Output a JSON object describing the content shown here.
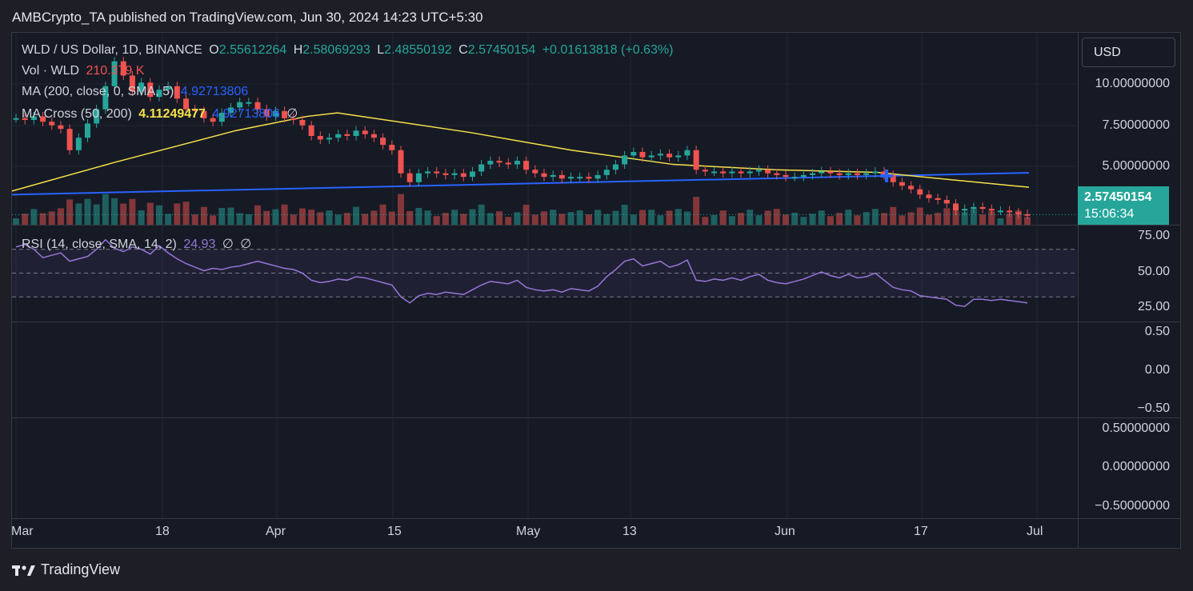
{
  "header": {
    "publish_text": "AMBCrypto_TA published on TradingView.com, Jun 30, 2024 14:23 UTC+5:30"
  },
  "legend": {
    "symbol": "WLD / US Dollar, 1D, BINANCE",
    "open_label": "O",
    "open": "2.55612264",
    "high_label": "H",
    "high": "2.58069293",
    "low_label": "L",
    "low": "2.48550192",
    "close_label": "C",
    "close": "2.57450154",
    "change": "+0.01613818 (+0.63%)",
    "vol_label": "Vol · WLD",
    "vol_value": "210.379 K",
    "ma_label": "MA (200, close, 0, SMA, 5)",
    "ma_value": "4.92713806",
    "macross_label": "MA Cross (50, 200)",
    "macross_value1": "4.11249477",
    "macross_value2": "4.92713806",
    "macross_extra": "∅",
    "rsi_label": "RSI (14, close, SMA, 14, 2)",
    "rsi_value": "24.93",
    "rsi_extra1": "∅",
    "rsi_extra2": "∅"
  },
  "currency_button": "USD",
  "price_axis": [
    "10.00000000",
    "7.50000000",
    "5.00000000"
  ],
  "last_price": "2.57450154",
  "countdown": "15:06:34",
  "rsi_axis": [
    "75.00",
    "50.00",
    "25.00"
  ],
  "pane3_axis": [
    "0.50",
    "0.00",
    "−0.50"
  ],
  "pane4_axis": [
    "0.50000000",
    "0.00000000",
    "−0.50000000"
  ],
  "time_axis": [
    "Mar",
    "18",
    "Apr",
    "15",
    "May",
    "13",
    "Jun",
    "17",
    "Jul"
  ],
  "brand": "TradingView",
  "colors": {
    "up": "#26a69a",
    "down": "#ef5350",
    "ma200": "#2962ff",
    "ma50": "#f7e14a",
    "rsi": "#9677d6",
    "background": "#161a25"
  },
  "chart_data": {
    "type": "candlestick",
    "symbol": "WLD / US Dollar, 1D, BINANCE",
    "x_range": [
      "Mar",
      "Jul"
    ],
    "price_ylim": [
      2.5,
      11.5
    ],
    "price_series_close": [
      8.0,
      7.9,
      8.1,
      7.8,
      7.6,
      7.4,
      6.2,
      6.9,
      7.7,
      8.5,
      9.8,
      11.2,
      10.4,
      9.5,
      10.0,
      9.2,
      9.6,
      9.8,
      9.1,
      8.5,
      8.4,
      8.0,
      7.8,
      8.3,
      8.6,
      8.9,
      8.9,
      8.5,
      8.1,
      8.4,
      8.0,
      7.9,
      7.6,
      7.0,
      6.8,
      6.9,
      7.1,
      7.0,
      7.3,
      7.1,
      6.9,
      6.5,
      6.2,
      4.9,
      4.4,
      4.9,
      5.0,
      4.9,
      4.8,
      4.9,
      4.7,
      5.0,
      5.4,
      5.6,
      5.5,
      5.4,
      5.6,
      5.1,
      4.9,
      4.7,
      4.8,
      4.6,
      4.7,
      4.7,
      4.6,
      4.8,
      5.1,
      5.4,
      5.9,
      6.1,
      5.8,
      5.9,
      6.0,
      5.8,
      5.9,
      6.2,
      5.1,
      5.0,
      5.0,
      4.9,
      5.0,
      4.9,
      5.0,
      5.1,
      4.9,
      4.8,
      4.7,
      4.7,
      4.8,
      4.9,
      5.0,
      4.9,
      4.8,
      4.9,
      4.8,
      4.9,
      5.0,
      4.8,
      4.4,
      4.2,
      4.0,
      3.7,
      3.5,
      3.4,
      3.2,
      2.8,
      2.9,
      3.0,
      2.9,
      2.8,
      2.8,
      2.7,
      2.6,
      2.57
    ],
    "ma200": {
      "name": "MA (200, close, 0, SMA, 5)",
      "start": 3.7,
      "end": 4.92713806
    },
    "ma50": {
      "name": "MA Cross (50, 200)",
      "points": [
        [
          0,
          3.9
        ],
        [
          0.1,
          5.5
        ],
        [
          0.22,
          7.3
        ],
        [
          0.29,
          8.1
        ],
        [
          0.32,
          8.3
        ],
        [
          0.45,
          7.2
        ],
        [
          0.55,
          6.2
        ],
        [
          0.65,
          5.4
        ],
        [
          0.75,
          5.1
        ],
        [
          0.85,
          4.95
        ],
        [
          1.0,
          4.11249477
        ]
      ]
    },
    "cross_marker_fraction": 0.86,
    "volume_units": "K",
    "rsi_ylim": [
      10,
      90
    ],
    "rsi_levels": [
      70,
      50,
      30
    ],
    "rsi_series": [
      72,
      74,
      70,
      63,
      65,
      67,
      60,
      62,
      64,
      70,
      78,
      71,
      68,
      72,
      70,
      66,
      73,
      67,
      62,
      58,
      55,
      52,
      54,
      53,
      55,
      56,
      58,
      60,
      58,
      56,
      54,
      53,
      50,
      44,
      42,
      43,
      45,
      44,
      47,
      46,
      44,
      42,
      40,
      30,
      25,
      31,
      33,
      32,
      34,
      33,
      32,
      36,
      40,
      43,
      42,
      41,
      44,
      38,
      36,
      35,
      36,
      34,
      37,
      36,
      35,
      39,
      47,
      53,
      60,
      62,
      56,
      58,
      60,
      55,
      57,
      61,
      44,
      43,
      45,
      44,
      46,
      44,
      47,
      49,
      44,
      42,
      41,
      43,
      45,
      48,
      51,
      48,
      46,
      49,
      46,
      47,
      50,
      44,
      38,
      36,
      35,
      31,
      30,
      29,
      28,
      23,
      22,
      28,
      28,
      27,
      28,
      27,
      26,
      24.93
    ]
  }
}
